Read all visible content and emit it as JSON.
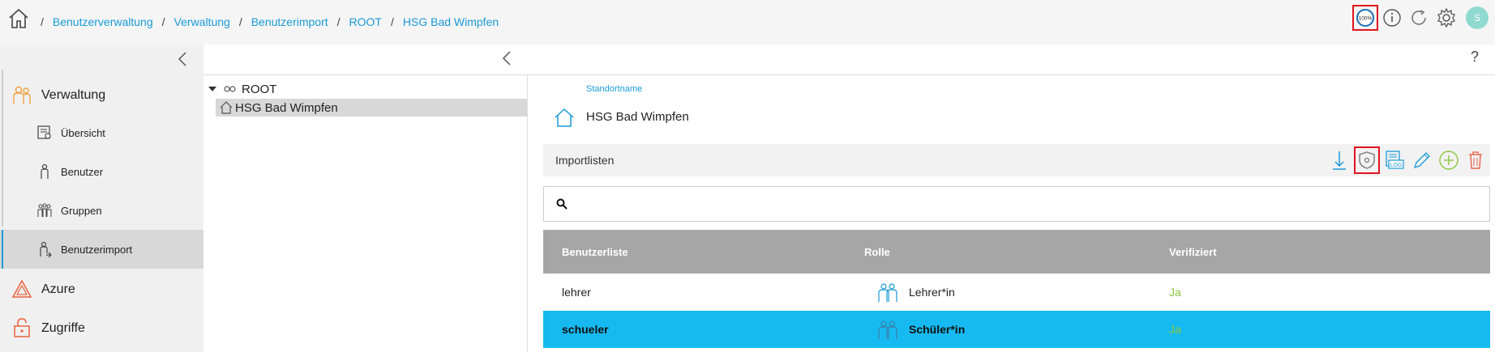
{
  "breadcrumb": {
    "items": [
      "Benutzerverwaltung",
      "Verwaltung",
      "Benutzerimport",
      "ROOT",
      "HSG Bad Wimpfen"
    ],
    "separator": "/"
  },
  "topbar": {
    "zoom": "100%",
    "avatar_initial": "S",
    "accent_color": "#1a9ad6",
    "highlight_color": "#e0141e"
  },
  "sidebar": {
    "sections": [
      {
        "label": "Verwaltung",
        "icon": "users-icon"
      },
      {
        "label": "Azure",
        "icon": "azure-icon"
      },
      {
        "label": "Zugriffe",
        "icon": "lock-icon"
      }
    ],
    "sub_items": [
      {
        "label": "Übersicht",
        "icon": "overview-icon"
      },
      {
        "label": "Benutzer",
        "icon": "user-icon"
      },
      {
        "label": "Gruppen",
        "icon": "group-icon"
      },
      {
        "label": "Benutzerimport",
        "icon": "user-import-icon",
        "active": true
      }
    ]
  },
  "tree": {
    "root": "ROOT",
    "child": "HSG Bad Wimpfen"
  },
  "location": {
    "label": "Standortname",
    "name": "HSG Bad Wimpfen"
  },
  "importlist": {
    "title": "Importlisten",
    "search_placeholder": "",
    "columns": [
      "Benutzerliste",
      "Rolle",
      "Verifiziert"
    ],
    "rows": [
      {
        "list": "lehrer",
        "role": "Lehrer*in",
        "verified": "Ja",
        "selected": false
      },
      {
        "list": "schueler",
        "role": "Schüler*in",
        "verified": "Ja",
        "selected": true
      }
    ]
  },
  "help": "?"
}
